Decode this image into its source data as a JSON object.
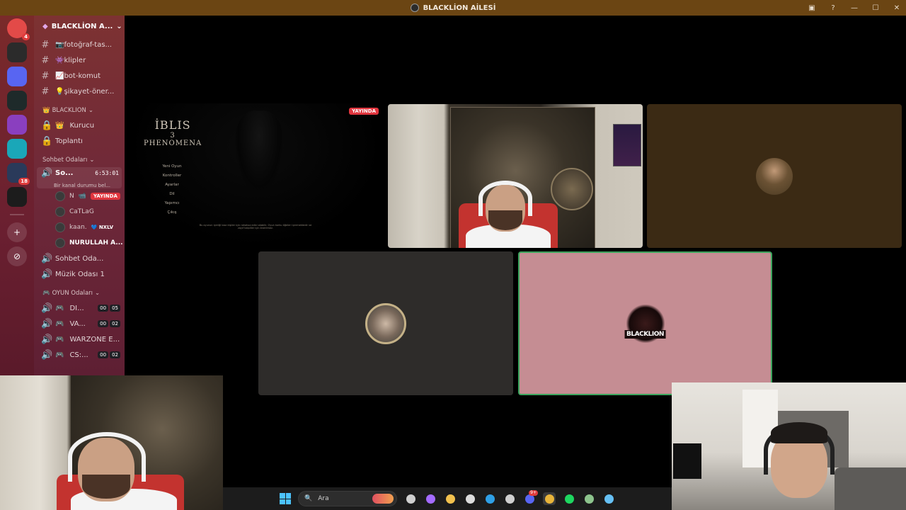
{
  "window": {
    "title": "BLACKLİON AİLESİ"
  },
  "rail": {
    "servers": [
      {
        "name": "discord-home",
        "color": "#e34a48",
        "badge": "4"
      },
      {
        "name": "server-blacklion",
        "color": "#2b2b2b",
        "badge": ""
      },
      {
        "name": "server-2",
        "color": "#5865f2",
        "badge": ""
      },
      {
        "name": "server-3",
        "color": "#1e2a2a",
        "badge": ""
      },
      {
        "name": "server-4",
        "color": "#8a3fbf",
        "badge": ""
      },
      {
        "name": "server-5",
        "color": "#1aa7b8",
        "badge": ""
      },
      {
        "name": "server-6",
        "color": "#2a3a5a",
        "badge": "18"
      },
      {
        "name": "server-7",
        "color": "#1c1c1c",
        "badge": ""
      }
    ]
  },
  "sidebar": {
    "server_name": "BLACKLİON A...",
    "channels_top": [
      {
        "label": "📷fotoğraf-tas..."
      },
      {
        "label": "👾klipler"
      },
      {
        "label": "📈bot-komut"
      },
      {
        "label": "💡şikayet-öner..."
      }
    ],
    "category_blacklion": "BLACKLION",
    "locked_channels": [
      {
        "label": "Kurucu",
        "emoji": "👑"
      },
      {
        "label": "Toplantı",
        "emoji": ""
      }
    ],
    "category_sohbet": "Sohbet Odaları",
    "active_voice": {
      "name": "So...",
      "timer": "6:53:01",
      "status": "Bir kanal durumu bel..."
    },
    "voice_users": [
      {
        "name": "N",
        "badge": "YAYINDA",
        "tag": ""
      },
      {
        "name": "CaTLaG",
        "badge": "",
        "tag": ""
      },
      {
        "name": "kaan.",
        "badge": "",
        "tag": "NXLV"
      },
      {
        "name": "NURULLAH A...",
        "badge": "",
        "tag": ""
      }
    ],
    "voice_channels": [
      {
        "label": "Sohbet Oda..."
      },
      {
        "label": "Müzik Odası 1"
      }
    ],
    "category_oyun": "OYUN Odaları",
    "game_channels": [
      {
        "label": "DI...",
        "c1": "00",
        "c2": "05"
      },
      {
        "label": "VA...",
        "c1": "00",
        "c2": "02"
      },
      {
        "label": "WARZONE E...",
        "c1": "",
        "c2": ""
      },
      {
        "label": "CS:...",
        "c1": "00",
        "c2": "02"
      }
    ]
  },
  "stream_tile": {
    "live_badge": "YAYINDA",
    "game_title_1": "İBLIS",
    "game_title_2": "3",
    "game_title_3": "PHENOMENA",
    "menu": [
      "Yeni Oyun",
      "Kontroller",
      "Ayarlar",
      "Dil",
      "Yapımcı",
      "Çıkış"
    ],
    "quote": "Bu oyunun içeriği bazı kişiler için rahatsız edici olabilir. Oyun korku öğeleri içermektedir ve zayıf kalpliler için önerilmez."
  },
  "tiles": {
    "user3_logo": "BLACKLION"
  },
  "taskbar": {
    "search_placeholder": "Ara",
    "icons": [
      {
        "name": "task-view-icon",
        "color": "#cfcfcf",
        "badge": ""
      },
      {
        "name": "copilot-icon",
        "color": "#a46bff",
        "badge": ""
      },
      {
        "name": "file-explorer-icon",
        "color": "#f2c14e",
        "badge": ""
      },
      {
        "name": "store-icon",
        "color": "#dcdcdc",
        "badge": ""
      },
      {
        "name": "edge-icon",
        "color": "#2fa0e6",
        "badge": ""
      },
      {
        "name": "settings-icon",
        "color": "#cfcfcf",
        "badge": ""
      },
      {
        "name": "discord-icon",
        "color": "#5865f2",
        "badge": "9+"
      },
      {
        "name": "chrome-icon",
        "color": "#e8b43a",
        "badge": ""
      },
      {
        "name": "spotify-icon",
        "color": "#1ed760",
        "badge": ""
      },
      {
        "name": "xbox-icon",
        "color": "#8dc48d",
        "badge": ""
      },
      {
        "name": "steam-icon",
        "color": "#66c0f4",
        "badge": ""
      }
    ]
  }
}
